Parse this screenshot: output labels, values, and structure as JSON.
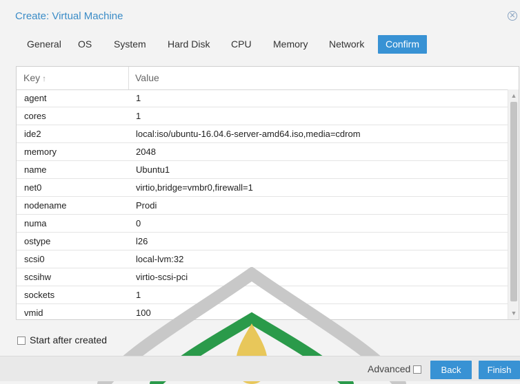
{
  "window": {
    "title": "Create: Virtual Machine"
  },
  "tabs": [
    {
      "label": "General"
    },
    {
      "label": "OS"
    },
    {
      "label": "System"
    },
    {
      "label": "Hard Disk"
    },
    {
      "label": "CPU"
    },
    {
      "label": "Memory"
    },
    {
      "label": "Network"
    },
    {
      "label": "Confirm",
      "active": true
    }
  ],
  "grid": {
    "columns": {
      "key": "Key",
      "value": "Value"
    },
    "sort_icon": "arrow-up-icon",
    "rows": [
      {
        "key": "agent",
        "value": "1"
      },
      {
        "key": "cores",
        "value": "1"
      },
      {
        "key": "ide2",
        "value": "local:iso/ubuntu-16.04.6-server-amd64.iso,media=cdrom"
      },
      {
        "key": "memory",
        "value": "2048"
      },
      {
        "key": "name",
        "value": "Ubuntu1"
      },
      {
        "key": "net0",
        "value": "virtio,bridge=vmbr0,firewall=1"
      },
      {
        "key": "nodename",
        "value": "Prodi"
      },
      {
        "key": "numa",
        "value": "0"
      },
      {
        "key": "ostype",
        "value": "l26"
      },
      {
        "key": "scsi0",
        "value": "local-lvm:32"
      },
      {
        "key": "scsihw",
        "value": "virtio-scsi-pci"
      },
      {
        "key": "sockets",
        "value": "1"
      },
      {
        "key": "vmid",
        "value": "100"
      }
    ]
  },
  "start_after_created": {
    "label": "Start after created",
    "checked": false
  },
  "footer": {
    "advanced_label": "Advanced",
    "advanced_checked": false,
    "back_label": "Back",
    "finish_label": "Finish"
  },
  "colors": {
    "accent": "#3892d4",
    "title": "#3b8cc7",
    "watermark_gray": "#c8c8c8",
    "watermark_green": "#2a9a4a",
    "watermark_gold": "#e8c75a"
  }
}
